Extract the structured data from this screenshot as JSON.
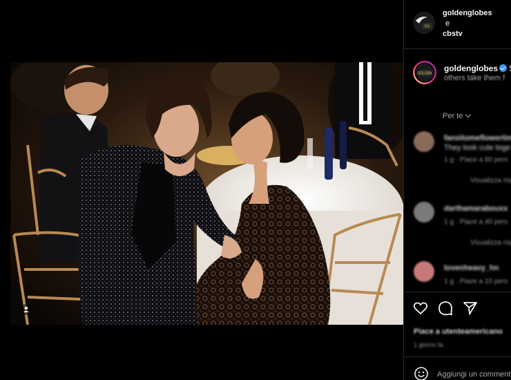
{
  "post": {
    "image": {
      "icon": "person-tag-icon"
    }
  },
  "header": {
    "users": [
      "goldenglobes",
      "cbstv"
    ],
    "conjunction": "e"
  },
  "caption": {
    "username": "goldenglobes",
    "snippet": "S",
    "line2": "others take them f"
  },
  "comments": {
    "sort_label": "Per te",
    "items": [
      {
        "username": "fansitomeflowertime",
        "text": "They look cute toge",
        "meta": "1 g · Piace a 80 pers",
        "replies": "Visualizza risposte"
      },
      {
        "username": "darthamarabouxx",
        "text": "",
        "meta": "1 g · Piace a 40 pers",
        "replies": "Visualizza risposte"
      },
      {
        "username": "lovenheavy_hn",
        "text": "",
        "meta": "1 g · Piace a 10 pers",
        "replies": ""
      }
    ]
  },
  "actions": {
    "like_icon": "heart-icon",
    "comment_icon": "comment-bubble-icon",
    "share_icon": "paper-plane-icon"
  },
  "likes_text": "Piace a utenteamericano",
  "post_date": "1 giorno fa",
  "add_comment": {
    "placeholder": "Aggiungi un commento..."
  },
  "colors": {
    "background": "#000000",
    "divider": "#262626",
    "verified_blue": "#3897f0",
    "text_primary": "#f5f5f5",
    "text_secondary": "#a8a8a8"
  }
}
